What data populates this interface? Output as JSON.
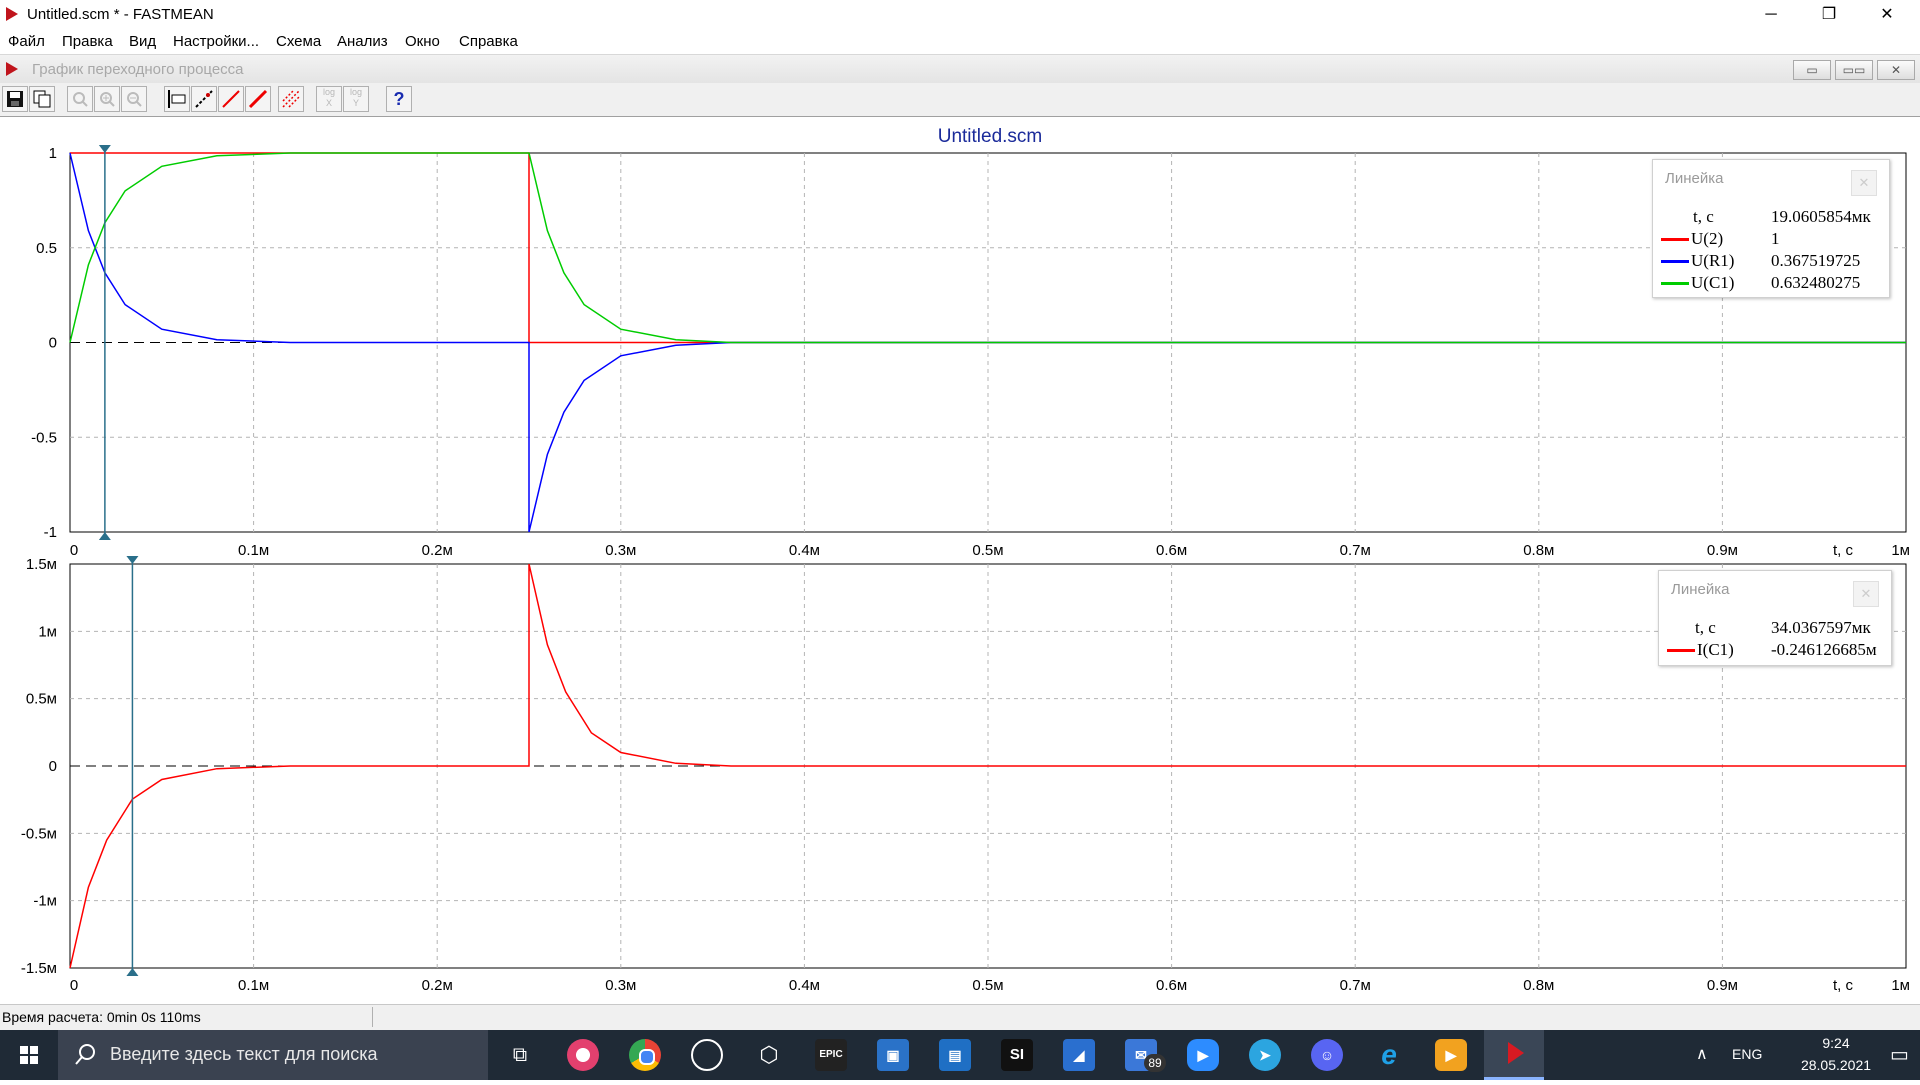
{
  "window": {
    "title": "Untitled.scm * - FASTMEAN",
    "minimize": "─",
    "restore": "❐",
    "close": "✕"
  },
  "menu": [
    "Файл",
    "Правка",
    "Вид",
    "Настройки...",
    "Схема",
    "Анализ",
    "Окно",
    "Справка"
  ],
  "child_window": {
    "title": "График переходного процесса",
    "buttons": [
      "▭",
      "▭▭",
      "✕"
    ]
  },
  "toolbar": {
    "items": [
      {
        "icon": "save-icon",
        "glyph": "■"
      },
      {
        "icon": "copy-icon",
        "glyph": "⧉"
      },
      {
        "icon": "zoom-icon",
        "glyph": "○"
      },
      {
        "icon": "zoom-in-icon",
        "glyph": "⊕"
      },
      {
        "icon": "zoom-out-icon",
        "glyph": "⊖"
      },
      {
        "icon": "ruler-icon",
        "glyph": "⊢"
      },
      {
        "icon": "line-dash-icon",
        "glyph": "⁄"
      },
      {
        "icon": "line-red-icon",
        "glyph": "╱"
      },
      {
        "icon": "line-bold-icon",
        "glyph": "╱"
      },
      {
        "icon": "grid-icon",
        "glyph": "▦"
      },
      {
        "icon": "log-x-icon",
        "glyph": "log X"
      },
      {
        "icon": "log-y-icon",
        "glyph": "log Y"
      },
      {
        "icon": "help-icon",
        "glyph": "?"
      }
    ]
  },
  "chart_title": "Untitled.scm",
  "chart_data": [
    {
      "type": "line",
      "title": "Untitled.scm",
      "xlabel": "t, c",
      "x_ticks": [
        "0",
        "0.1м",
        "0.2м",
        "0.3м",
        "0.4м",
        "0.5м",
        "0.6м",
        "0.7м",
        "0.8м",
        "0.9м",
        "1м"
      ],
      "xlim_ms": [
        0,
        1.0
      ],
      "y_ticks": [
        "1",
        "0.5",
        "0",
        "-0.5",
        "-1"
      ],
      "ylim": [
        -1,
        1
      ],
      "grid": true,
      "cursor_t": "19.0605854мк",
      "series": [
        {
          "name": "U(2)",
          "color": "#ff0000",
          "x_ms": [
            0,
            0.25,
            0.25,
            1.0
          ],
          "y": [
            1,
            1,
            0,
            0
          ]
        },
        {
          "name": "U(R1)",
          "color": "#0000ff",
          "x_ms": [
            0,
            0.01,
            0.019,
            0.03,
            0.05,
            0.08,
            0.12,
            0.25,
            0.25,
            0.26,
            0.269,
            0.28,
            0.3,
            0.33,
            0.36,
            1.0
          ],
          "y": [
            1,
            0.59,
            0.368,
            0.2,
            0.07,
            0.015,
            0,
            0,
            -1,
            -0.59,
            -0.368,
            -0.2,
            -0.07,
            -0.015,
            0,
            0
          ]
        },
        {
          "name": "U(C1)",
          "color": "#00cc00",
          "x_ms": [
            0,
            0.01,
            0.019,
            0.03,
            0.05,
            0.08,
            0.12,
            0.25,
            0.26,
            0.269,
            0.28,
            0.3,
            0.33,
            0.36,
            1.0
          ],
          "y": [
            0,
            0.41,
            0.632,
            0.8,
            0.93,
            0.985,
            1,
            1,
            0.59,
            0.368,
            0.2,
            0.07,
            0.015,
            0,
            0
          ]
        }
      ],
      "ruler": {
        "title": "Линейка",
        "rows": [
          {
            "name": "t, c",
            "value": "19.0605854мк"
          },
          {
            "name": "U(2)",
            "value": "1"
          },
          {
            "name": "U(R1)",
            "value": "0.367519725"
          },
          {
            "name": "U(C1)",
            "value": "0.632480275"
          }
        ]
      }
    },
    {
      "type": "line",
      "xlabel": "t, c",
      "x_ticks": [
        "0",
        "0.1м",
        "0.2м",
        "0.3м",
        "0.4м",
        "0.5м",
        "0.6м",
        "0.7м",
        "0.8м",
        "0.9м",
        "1м"
      ],
      "xlim_ms": [
        0,
        1.0
      ],
      "y_ticks": [
        "1.5м",
        "1м",
        "0.5м",
        "0",
        "-0.5м",
        "-1м",
        "-1.5м"
      ],
      "ylim_mA": [
        -1.5,
        1.5
      ],
      "grid": true,
      "cursor_t": "34.0367597мк",
      "series": [
        {
          "name": "I(C1)",
          "color": "#ff0000",
          "x_ms": [
            0,
            0.01,
            0.02,
            0.034,
            0.05,
            0.08,
            0.12,
            0.25,
            0.25,
            0.26,
            0.27,
            0.284,
            0.3,
            0.33,
            0.36,
            1.0
          ],
          "y": [
            -1.5,
            -0.9,
            -0.55,
            -0.246,
            -0.1,
            -0.02,
            0,
            0,
            1.5,
            0.9,
            0.55,
            0.246,
            0.1,
            0.02,
            0,
            0
          ]
        }
      ],
      "ruler": {
        "title": "Линейка",
        "rows": [
          {
            "name": "t, c",
            "value": "34.0367597мк"
          },
          {
            "name": "I(C1)",
            "value": "-0.246126685м"
          }
        ]
      }
    }
  ],
  "status": {
    "text": "Время расчета: 0min 0s 110ms"
  },
  "taskbar": {
    "search_placeholder": "Введите здесь текст для поиска",
    "apps": [
      "task-view",
      "itunes",
      "chrome",
      "steam",
      "unity",
      "epic-games",
      "app-blue",
      "app-news",
      "si-game",
      "app-paint",
      "mail",
      "zoom",
      "telegram",
      "discord",
      "ie",
      "media",
      "fastmean"
    ],
    "mail_badge": "89",
    "epic_label": "EPIC",
    "si_label": "SI",
    "lang": "ENG",
    "time": "9:24",
    "date": "28.05.2021"
  }
}
